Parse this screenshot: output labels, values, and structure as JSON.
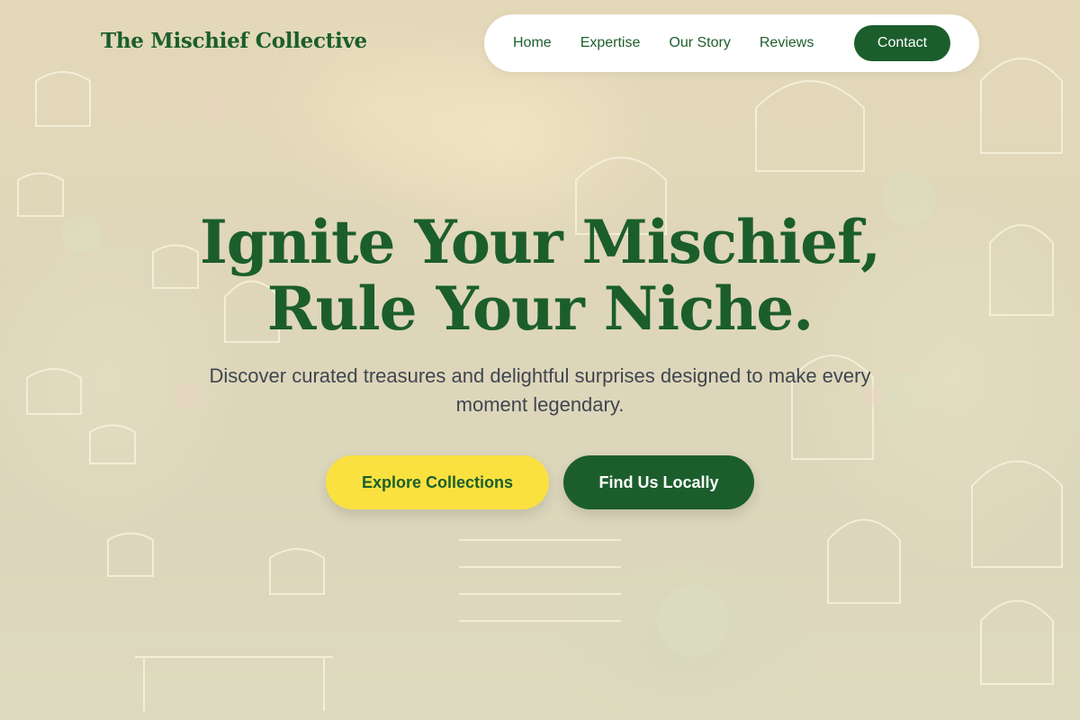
{
  "brand": {
    "name": "The Mischief Collective"
  },
  "nav": {
    "items": [
      "Home",
      "Expertise",
      "Our Story",
      "Reviews"
    ],
    "cta": "Contact"
  },
  "hero": {
    "title_line1": "Ignite Your Mischief,",
    "title_line2": "Rule Your Niche.",
    "subtitle": "Discover curated treasures and delightful surprises designed to make every moment legendary.",
    "primary_cta": "Explore Collections",
    "secondary_cta": "Find Us Locally"
  },
  "colors": {
    "brand_green": "#1b5e2c",
    "accent_yellow": "#fbe13f",
    "nav_background": "#ffffff",
    "overlay_tint": "#f4f0d6"
  }
}
